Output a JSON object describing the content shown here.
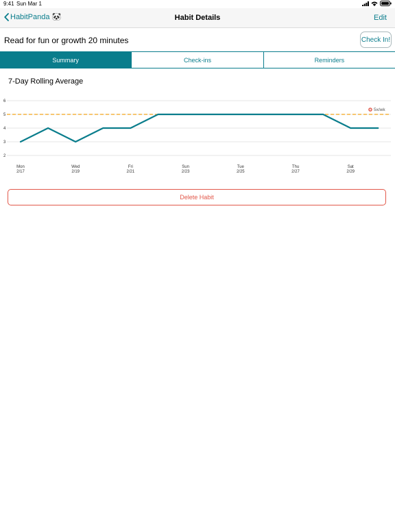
{
  "status": {
    "time": "9:41",
    "date": "Sun Mar 1"
  },
  "nav": {
    "back_label": "HabitPanda 🐼",
    "title": "Habit Details",
    "edit_label": "Edit"
  },
  "habit": {
    "name": "Read for fun or growth 20 minutes",
    "checkin_label": "Check In!"
  },
  "tabs": [
    {
      "label": "Summary",
      "active": true
    },
    {
      "label": "Check-ins",
      "active": false
    },
    {
      "label": "Reminders",
      "active": false
    }
  ],
  "summary": {
    "section_title": "7-Day Rolling Average"
  },
  "chart_data": {
    "type": "line",
    "title": "7-Day Rolling Average",
    "x": [
      "2/17",
      "2/18",
      "2/19",
      "2/20",
      "2/21",
      "2/22",
      "2/23",
      "2/24",
      "2/25",
      "2/26",
      "2/27",
      "2/28",
      "2/29",
      "3/1"
    ],
    "series": [
      {
        "values": [
          3,
          4,
          3,
          4,
          4,
          5,
          5,
          5,
          5,
          5,
          5,
          5,
          4,
          4
        ],
        "color": "#0a7d8c"
      }
    ],
    "x_ticks": [
      {
        "day": "Mon",
        "date": "2/17"
      },
      {
        "day": "Wed",
        "date": "2/19"
      },
      {
        "day": "Fri",
        "date": "2/21"
      },
      {
        "day": "Sun",
        "date": "2/23"
      },
      {
        "day": "Tue",
        "date": "2/25"
      },
      {
        "day": "Thu",
        "date": "2/27"
      },
      {
        "day": "Sat",
        "date": "2/29"
      }
    ],
    "y_ticks": [
      "2",
      "3",
      "4",
      "5",
      "6"
    ],
    "ylim": [
      2,
      6
    ],
    "grid": true,
    "target": {
      "value": 5,
      "label": "5x/wk",
      "color": "#f2a31b",
      "icon": "target-icon"
    }
  },
  "actions": {
    "delete_label": "Delete Habit"
  },
  "colors": {
    "accent": "#0a7d8c",
    "danger": "#e2584a",
    "target": "#f2a31b"
  }
}
